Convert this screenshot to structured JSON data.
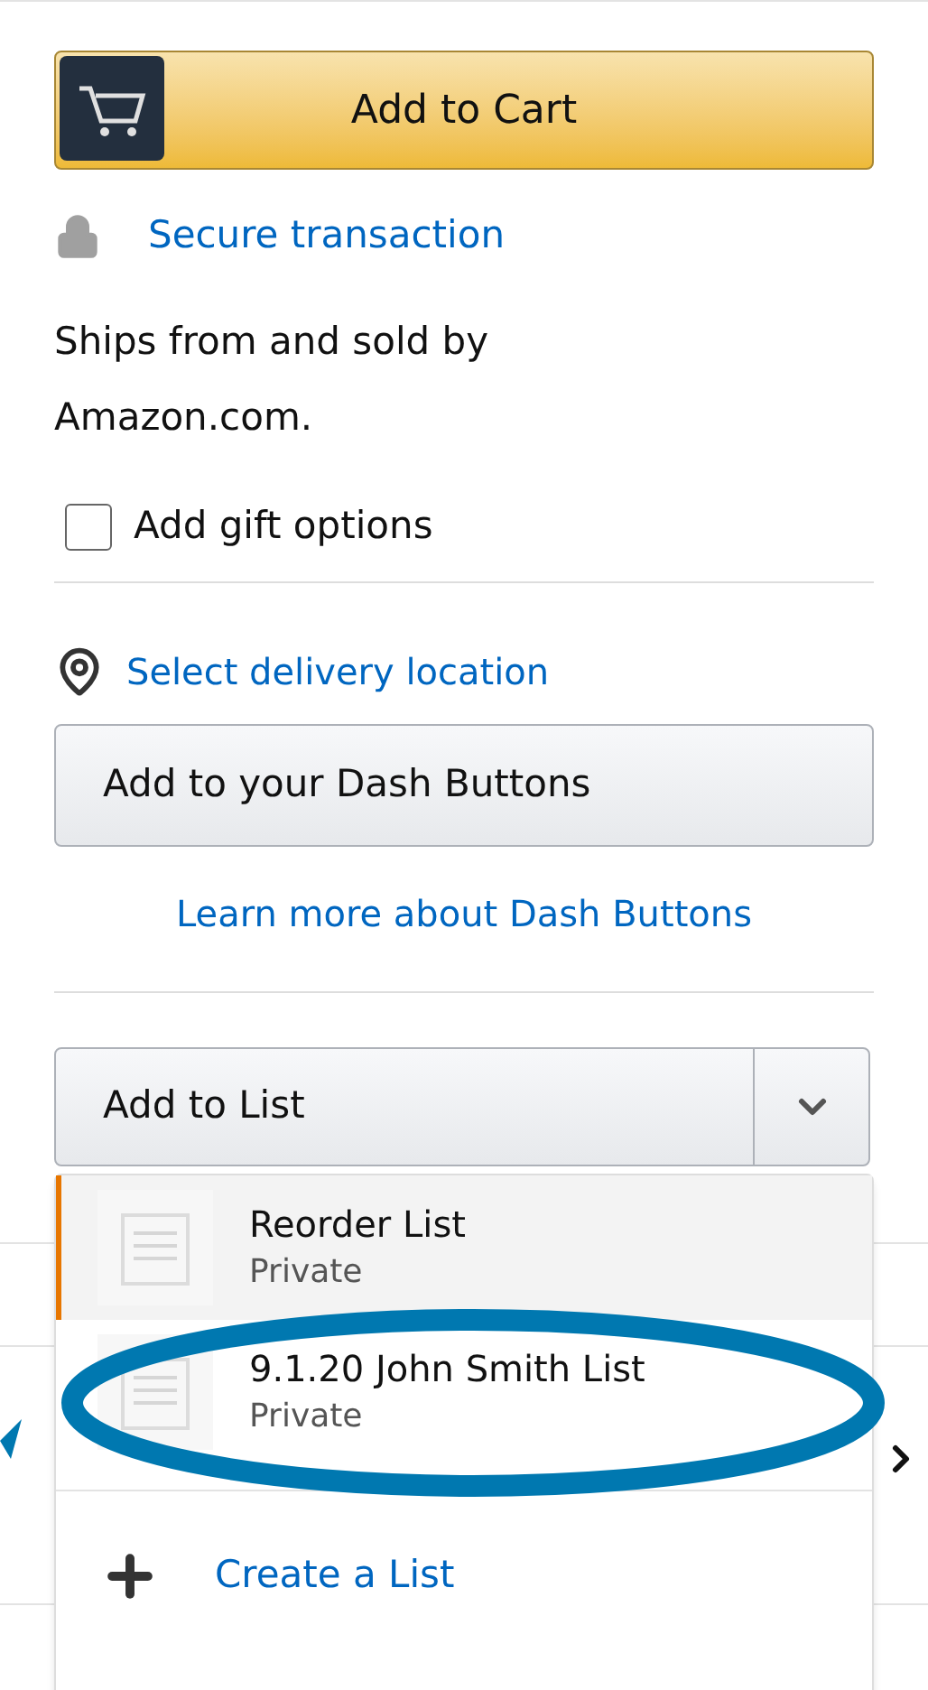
{
  "add_to_cart": {
    "label": "Add to Cart"
  },
  "secure": {
    "label": "Secure transaction"
  },
  "ships_from": "Ships from and sold by Amazon.com.",
  "gift_options": {
    "label": "Add gift options",
    "checked": false
  },
  "delivery": {
    "label": "Select delivery location"
  },
  "dash_button": {
    "label": "Add to your Dash Buttons"
  },
  "dash_learn_more": "Learn more about Dash Buttons",
  "add_to_list": {
    "label": "Add to List",
    "expanded": true
  },
  "lists": [
    {
      "name": "Reorder List",
      "privacy": "Private",
      "selected": true
    },
    {
      "name": "9.1.20 John Smith List",
      "privacy": "Private",
      "selected": false
    }
  ],
  "create_list": {
    "label": "Create a List"
  }
}
